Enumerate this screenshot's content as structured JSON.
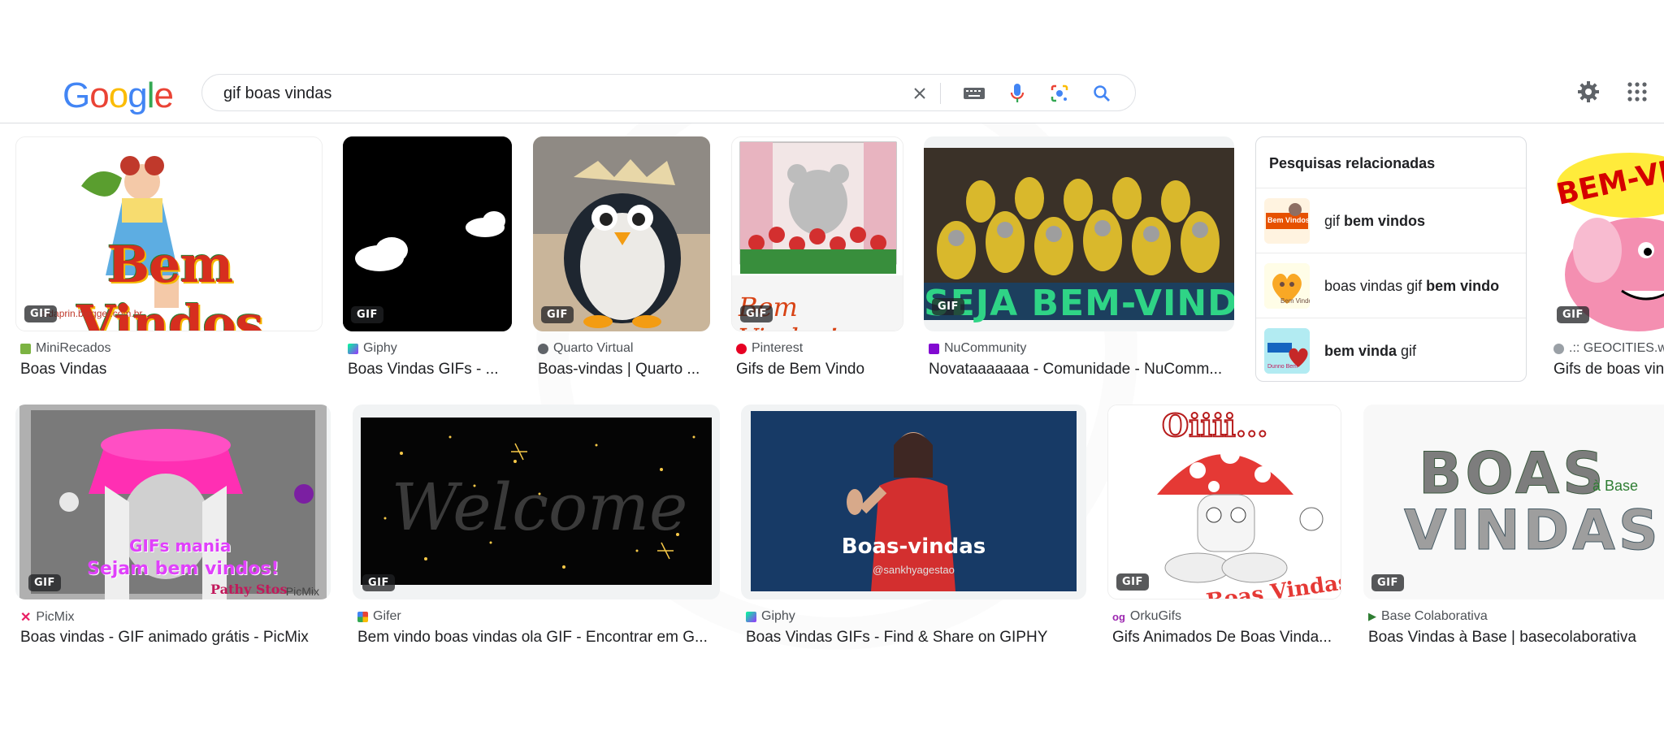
{
  "search": {
    "query": "gif boas vindas"
  },
  "logo": {
    "letters": [
      "G",
      "o",
      "o",
      "g",
      "l",
      "e"
    ],
    "colors": [
      "#4285F4",
      "#EA4335",
      "#FBBC05",
      "#4285F4",
      "#34A853",
      "#EA4335"
    ]
  },
  "badge_label": "GIF",
  "row1": [
    {
      "source": "MiniRecados",
      "title": "Boas Vindas",
      "favicon_color": "#7cb342",
      "thumb_text": "Bem Vindos",
      "watermark": "eidaprin.blogger.com.br"
    },
    {
      "source": "Giphy",
      "title": "Boas Vindas GIFs - ...",
      "favicon_color": "#111111"
    },
    {
      "source": "Quarto Virtual",
      "title": "Boas-vindas | Quarto ...",
      "favicon_color": "#5f6368"
    },
    {
      "source": "Pinterest",
      "title": "Gifs de Bem Vindo",
      "favicon_color": "#e60023",
      "thumb_text": "Bem Vindos!"
    },
    {
      "source": "NuCommunity",
      "title": "Novataaaaaaa - Comunidade - NuComm...",
      "favicon_color": "#820ad1",
      "thumb_text": "SEJA BEM-VINDA"
    },
    {
      "source": ".:: GEOCITIES.ws",
      "title": "Gifs de boas vindas",
      "favicon_color": "#9aa0a6",
      "thumb_text": "BEM-VINDO"
    }
  ],
  "related": {
    "title": "Pesquisas relacionadas",
    "items": [
      {
        "pre": "gif ",
        "bold": "bem vindos",
        "post": "",
        "thumb_text": "Bem Vindos"
      },
      {
        "pre": "boas vindas gif ",
        "bold": "bem vindo",
        "post": "",
        "thumb_text": "Bem Vindo"
      },
      {
        "pre": "",
        "bold": "bem vinda",
        "post": " gif",
        "thumb_text": "Dunno Bem"
      }
    ]
  },
  "row2": [
    {
      "source": "PicMix",
      "title": "Boas vindas - GIF animado grátis - PicMix",
      "favicon_color": "#e91e63",
      "thumb_line1": "GIFs mania",
      "thumb_line2": "Sejam bem vindos!",
      "thumb_line3": "Pathy Stos",
      "watermark": "PicMix"
    },
    {
      "source": "Gifer",
      "title": "Bem vindo boas vindas ola GIF - Encontrar em G...",
      "favicon_color": "#fbbc05",
      "thumb_text": "Welcome"
    },
    {
      "source": "Giphy",
      "title": "Boas Vindas GIFs - Find & Share on GIPHY",
      "favicon_color": "#111111",
      "thumb_text": "Boas-vindas",
      "thumb_sub": "@sankhyagestao"
    },
    {
      "source": "OrkuGifs",
      "title": "Gifs Animados De Boas Vinda...",
      "favicon_color": "#9c27b0",
      "thumb_text": "Oiiii...",
      "thumb_sub": "Boas Vindas!"
    },
    {
      "source": "Base Colaborativa",
      "title": "Boas Vindas à Base | basecolaborativa",
      "favicon_color": "#2e7d32",
      "thumb_line1": "BOAS",
      "thumb_line2": "VINDAS",
      "thumb_sub": "à Base"
    }
  ]
}
